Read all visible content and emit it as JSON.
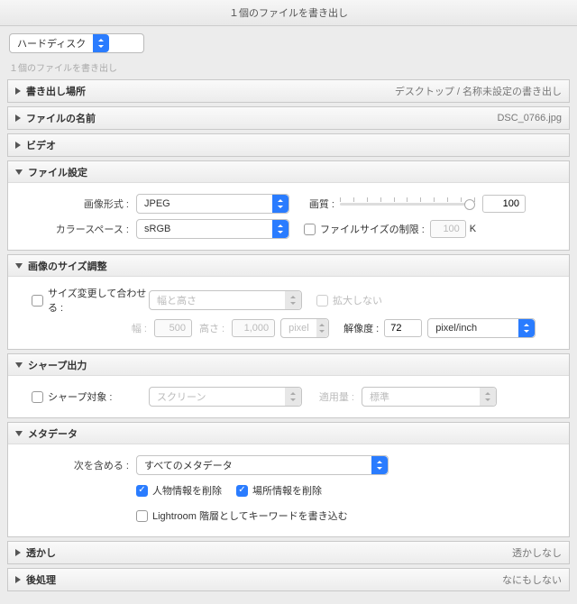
{
  "window": {
    "title": "１個のファイルを書き出し"
  },
  "toolbar": {
    "destination": "ハードディスク"
  },
  "subcaption": "１個のファイルを書き出し",
  "panels": {
    "location": {
      "title": "書き出し場所",
      "summary": "デスクトップ / 名称未設定の書き出し"
    },
    "filename": {
      "title": "ファイルの名前",
      "summary": "DSC_0766.jpg"
    },
    "video": {
      "title": "ビデオ"
    },
    "fileSettings": {
      "title": "ファイル設定",
      "formatLabel": "画像形式 :",
      "formatValue": "JPEG",
      "qualityLabel": "画質 :",
      "qualityValue": "100",
      "colorSpaceLabel": "カラースペース :",
      "colorSpaceValue": "sRGB",
      "limitLabel": "ファイルサイズの制限 :",
      "limitValue": "100",
      "limitUnit": "K"
    },
    "imageSize": {
      "title": "画像のサイズ調整",
      "resizeLabel": "サイズ変更して合わせる :",
      "resizeMode": "幅と高さ",
      "noEnlarge": "拡大しない",
      "widthLabel": "幅 :",
      "widthValue": "500",
      "heightLabel": "高さ :",
      "heightValue": "1,000",
      "dimUnit": "pixel",
      "resolutionLabel": "解像度 :",
      "resolutionValue": "72",
      "resolutionUnit": "pixel/inch"
    },
    "sharpen": {
      "title": "シャープ出力",
      "targetLabel": "シャープ対象 :",
      "targetValue": "スクリーン",
      "amountLabel": "適用量 :",
      "amountValue": "標準"
    },
    "metadata": {
      "title": "メタデータ",
      "includeLabel": "次を含める :",
      "includeValue": "すべてのメタデータ",
      "removePerson": "人物情報を削除",
      "removeLocation": "場所情報を削除",
      "writeKeywords": "Lightroom 階層としてキーワードを書き込む"
    },
    "watermark": {
      "title": "透かし",
      "summary": "透かしなし"
    },
    "post": {
      "title": "後処理",
      "summary": "なにもしない"
    }
  }
}
